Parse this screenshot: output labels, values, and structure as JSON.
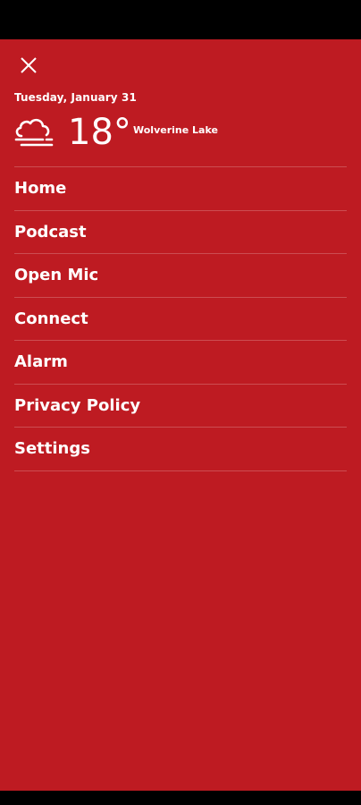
{
  "header": {
    "date": "Tuesday, January 31",
    "temperature": "18°",
    "location": "Wolverine Lake",
    "weather_icon": "cloud-fog-icon"
  },
  "menu": {
    "items": [
      {
        "label": "Home"
      },
      {
        "label": "Podcast"
      },
      {
        "label": "Open Mic"
      },
      {
        "label": "Connect"
      },
      {
        "label": "Alarm"
      },
      {
        "label": "Privacy Policy"
      },
      {
        "label": "Settings"
      }
    ]
  },
  "colors": {
    "drawer_background": "#be1b22",
    "text": "#ffffff",
    "system_bars": "#000000"
  }
}
